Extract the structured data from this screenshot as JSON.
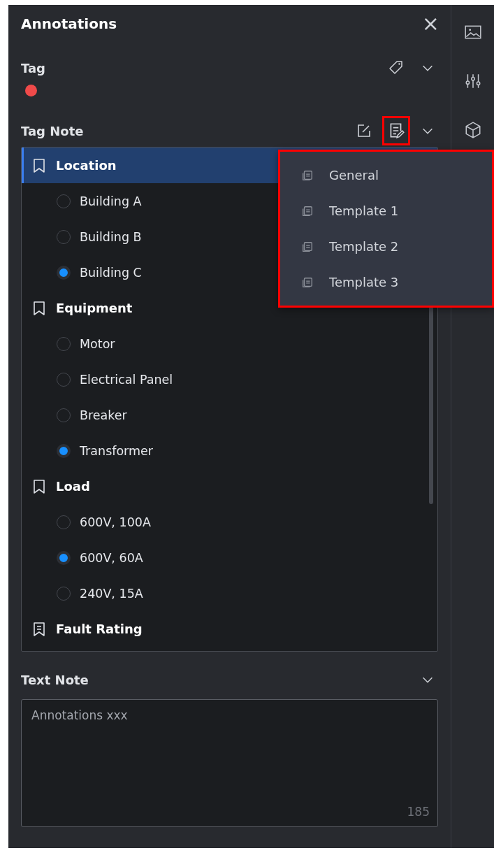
{
  "panel": {
    "title": "Annotations",
    "close": "×"
  },
  "tag": {
    "label": "Tag",
    "color": "#f04a4a"
  },
  "tag_note": {
    "label": "Tag Note",
    "template_button_highlighted": true,
    "groups": [
      {
        "label": "Location",
        "kind": "plain",
        "selected": true,
        "options": [
          {
            "label": "Building A",
            "checked": false
          },
          {
            "label": "Building B",
            "checked": false
          },
          {
            "label": "Building C",
            "checked": true
          }
        ]
      },
      {
        "label": "Equipment",
        "kind": "plain",
        "selected": false,
        "options": [
          {
            "label": "Motor",
            "checked": false
          },
          {
            "label": "Electrical Panel",
            "checked": false
          },
          {
            "label": "Breaker",
            "checked": false
          },
          {
            "label": "Transformer",
            "checked": true
          }
        ]
      },
      {
        "label": "Load",
        "kind": "plain",
        "selected": false,
        "options": [
          {
            "label": "600V, 100A",
            "checked": false
          },
          {
            "label": "600V, 60A",
            "checked": true
          },
          {
            "label": "240V, 15A",
            "checked": false
          }
        ]
      },
      {
        "label": "Fault Rating",
        "kind": "lined",
        "selected": false
      }
    ]
  },
  "template_menu": {
    "highlighted": true,
    "items": [
      "General",
      "Template 1",
      "Template 2",
      "Template 3"
    ]
  },
  "text_note": {
    "label": "Text Note",
    "placeholder": "Annotations xxx",
    "count": "185"
  }
}
